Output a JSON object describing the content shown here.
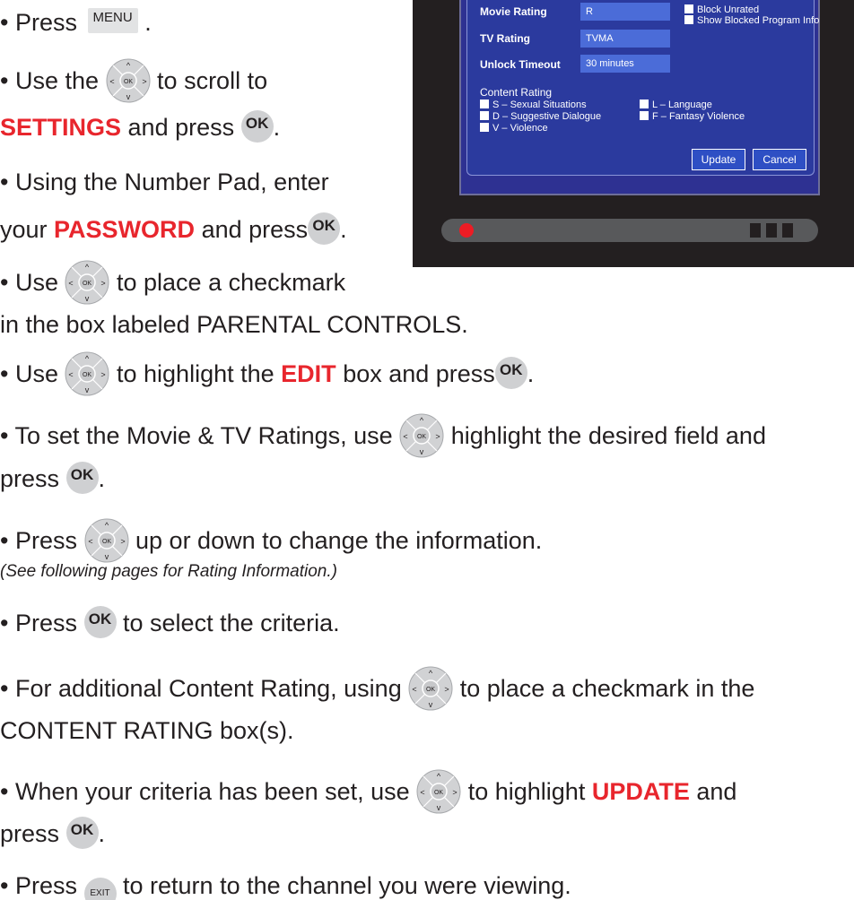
{
  "buttons": {
    "menu": "MENU",
    "ok": "OK",
    "exit": "EXIT",
    "dpad_ok": "OK"
  },
  "steps": [
    {
      "a": "• Press",
      "b": "."
    },
    {
      "a": "• Use the",
      "b": "to scroll to"
    },
    {
      "a": "SETTINGS",
      "b": "and press",
      "c": "."
    },
    {
      "a": "• Using the Number Pad, enter"
    },
    {
      "a": "your",
      "b": "PASSWORD",
      "c": "and press",
      "d": "."
    },
    {
      "a": "• Use",
      "b": "to place a checkmark"
    },
    {
      "a": "in the box labeled PARENTAL CONTROLS."
    },
    {
      "a": "• Use",
      "b": "to highlight the",
      "c": "EDIT",
      "d": "box and press",
      "e": "."
    },
    {
      "a": "• To set the Movie & TV Ratings, use",
      "b": "highlight the desired field and"
    },
    {
      "a": "press",
      "b": "."
    },
    {
      "a": "• Press",
      "b": "up or down to change the information."
    },
    {
      "a": "(See following pages for Rating Information.)"
    },
    {
      "a": "• Press",
      "b": "to select the criteria."
    },
    {
      "a": "• For additional Content Rating, using",
      "b": "to place a checkmark in the"
    },
    {
      "a": "CONTENT RATING box(s)."
    },
    {
      "a": "• When your criteria has been set, use",
      "b": "to highlight",
      "c": "UPDATE",
      "d": "and"
    },
    {
      "a": "press",
      "b": "."
    },
    {
      "a": "• Press",
      "b": "to return to the channel you were viewing."
    }
  ],
  "tv": {
    "movie_rating_label": "Movie Rating",
    "movie_rating_value": "R",
    "tv_rating_label": "TV Rating",
    "tv_rating_value": "TVMA",
    "unlock_timeout_label": "Unlock Timeout",
    "unlock_timeout_value": "30 minutes",
    "block_unrated": "Block Unrated",
    "show_blocked": "Show Blocked Program Info",
    "content_rating_title": "Content Rating",
    "content_items": {
      "s": "S – Sexual Situations",
      "d": "D – Suggestive Dialogue",
      "v": "V – Violence",
      "l": "L – Language",
      "f": "F – Fantasy Violence"
    },
    "update_label": "Update",
    "cancel_label": "Cancel"
  },
  "colors": {
    "highlight": "#e8262d",
    "screen": "#2e3192",
    "field": "#4b6cd8",
    "tv_body": "#231f20"
  },
  "icons": {
    "dpad": "dpad-icon",
    "ok": "ok-button-icon",
    "exit": "exit-button-icon",
    "menu": "menu-button-icon"
  }
}
